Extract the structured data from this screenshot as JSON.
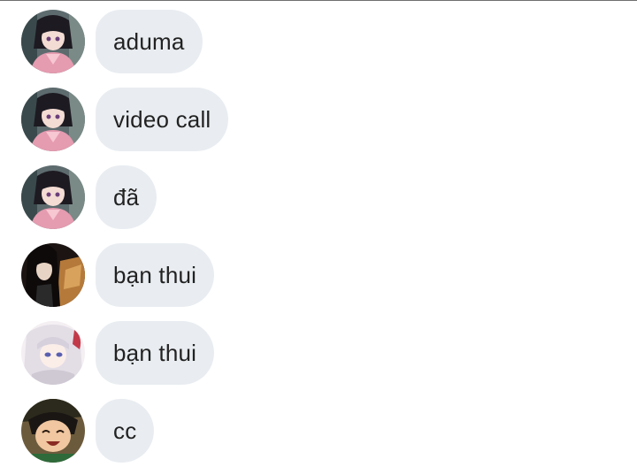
{
  "messages": [
    {
      "avatar": "avatar-girl-pink-kimono",
      "text": "aduma"
    },
    {
      "avatar": "avatar-girl-pink-kimono",
      "text": "video call"
    },
    {
      "avatar": "avatar-girl-pink-kimono",
      "text": "đã"
    },
    {
      "avatar": "avatar-dark-hair-character",
      "text": "bạn thui"
    },
    {
      "avatar": "avatar-white-hair-character",
      "text": "bạn thui"
    },
    {
      "avatar": "avatar-smiling-boy",
      "text": "cc"
    }
  ],
  "colors": {
    "bubble_bg": "#e9edf1",
    "text": "#222222",
    "background": "#ffffff"
  }
}
